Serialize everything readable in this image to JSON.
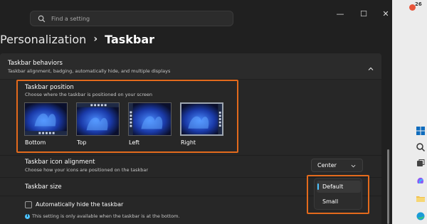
{
  "titlebar": {
    "search_placeholder": "Find a setting",
    "minimize": "—",
    "maximize": "☐",
    "close": "✕"
  },
  "breadcrumb": {
    "parent": "Personalization",
    "separator": "›",
    "current": "Taskbar"
  },
  "behaviors": {
    "title": "Taskbar behaviors",
    "subtitle": "Taskbar alignment, badging, automatically hide, and multiple displays"
  },
  "position": {
    "title": "Taskbar position",
    "subtitle": "Choose where the taskbar is positioned on your screen",
    "options": [
      {
        "label": "Bottom",
        "selected": false
      },
      {
        "label": "Top",
        "selected": false
      },
      {
        "label": "Left",
        "selected": false
      },
      {
        "label": "Right",
        "selected": true
      }
    ]
  },
  "alignment": {
    "title": "Taskbar icon alignment",
    "subtitle": "Choose how your icons are positioned on the taskbar",
    "value": "Center"
  },
  "size": {
    "title": "Taskbar size",
    "options": [
      "Default",
      "Small"
    ],
    "selected": "Default"
  },
  "autohide": {
    "label": "Automatically hide the taskbar",
    "checked": false,
    "note": "This setting is only available when the taskbar is at the bottom."
  },
  "tray": {
    "badge": "26"
  },
  "colors": {
    "accent": "#4cc2ff",
    "highlight": "#e36a1c"
  }
}
